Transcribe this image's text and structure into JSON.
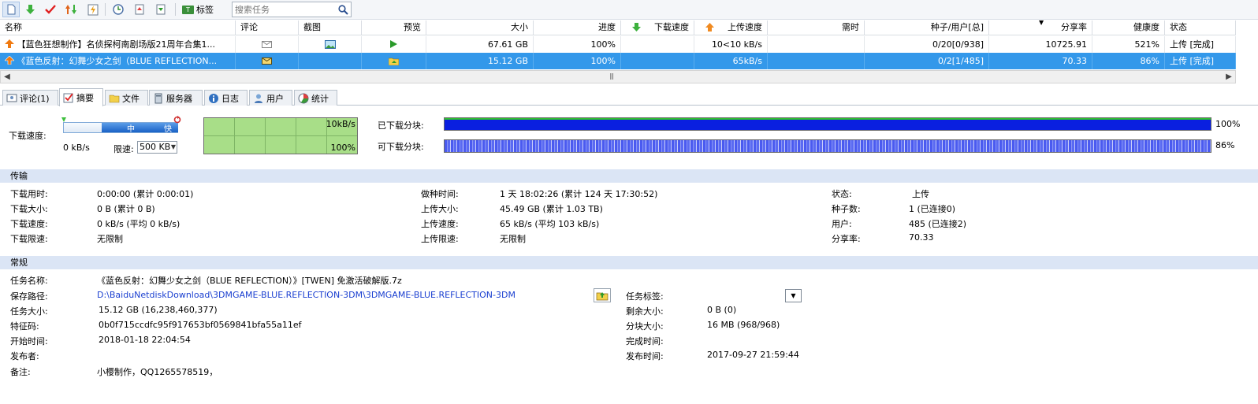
{
  "toolbar": {
    "tag_label": "标签",
    "search_placeholder": "搜索任务",
    "buttons": [
      "new-task-icon",
      "download-icon",
      "check-icon",
      "priority-icon",
      "lightning-icon",
      "schedule-icon",
      "import-icon",
      "export-icon"
    ]
  },
  "columns": {
    "name": "名称",
    "comment": "评论",
    "screenshot": "截图",
    "preview": "预览",
    "size": "大小",
    "progress": "进度",
    "down_speed": "下载速度",
    "up_speed": "上传速度",
    "time_left": "需时",
    "seeds_users": "种子/用户[总]",
    "share_ratio": "分享率",
    "health": "健康度",
    "status": "状态"
  },
  "tasks": [
    {
      "name": "【蓝色狂想制作】名侦探柯南剧场版21周年合集1...",
      "size": "67.61 GB",
      "progress": "100%",
      "down_speed": "",
      "up_speed": "10<10 kB/s",
      "time_left": "",
      "seeds_users": "0/20[0/938]",
      "share_ratio": "10725.91",
      "health": "521%",
      "status": "上传 [完成]"
    },
    {
      "name": "《蓝色反射：幻舞少女之剑（BLUE REFLECTION...",
      "size": "15.12 GB",
      "progress": "100%",
      "down_speed": "",
      "up_speed": "65kB/s",
      "time_left": "",
      "seeds_users": "0/2[1/485]",
      "share_ratio": "70.33",
      "health": "86%",
      "status": "上传 [完成]"
    }
  ],
  "tabs": [
    {
      "label": "评论(1)",
      "icon": "comment-icon"
    },
    {
      "label": "摘要",
      "icon": "summary-icon"
    },
    {
      "label": "文件",
      "icon": "folder-icon"
    },
    {
      "label": "服务器",
      "icon": "server-icon"
    },
    {
      "label": "日志",
      "icon": "info-icon"
    },
    {
      "label": "用户",
      "icon": "user-icon"
    },
    {
      "label": "统计",
      "icon": "stats-icon"
    }
  ],
  "speed": {
    "label": "下载速度:",
    "slider_mid": "中",
    "slider_fast": "快",
    "current": "0 kB/s",
    "limit_label": "限速:",
    "limit_value": "500 KB",
    "graph_top": "10kB/s",
    "graph_bottom": "100%"
  },
  "progress": {
    "downloaded_label": "已下载分块:",
    "downloaded_pct": "100%",
    "downloaded_fraction": 1.0,
    "available_label": "可下载分块:",
    "available_pct": "86%",
    "available_fraction": 0.86
  },
  "transfer": {
    "title": "传输",
    "download_time_label": "下载用时:",
    "download_time": "0:00:00 (累计 0:00:01)",
    "download_size_label": "下载大小:",
    "download_size": "0 B (累计 0 B)",
    "download_speed_label": "下载速度:",
    "download_speed": "0 kB/s (平均 0 kB/s)",
    "download_limit_label": "下载限速:",
    "download_limit": "无限制",
    "seed_time_label": "做种时间:",
    "seed_time": "1 天 18:02:26 (累计 124 天 17:30:52)",
    "upload_size_label": "上传大小:",
    "upload_size": "45.49 GB (累计 1.03 TB)",
    "upload_speed_label": "上传速度:",
    "upload_speed": "65 kB/s (平均 103 kB/s)",
    "upload_limit_label": "上传限速:",
    "upload_limit": "无限制",
    "status_label": "状态:",
    "status": "上传",
    "seeds_label": "种子数:",
    "seeds": "1 (已连接0)",
    "users_label": "用户:",
    "users": "485 (已连接2)",
    "ratio_label": "分享率:",
    "ratio": "70.33"
  },
  "general": {
    "title": "常规",
    "name_label": "任务名称:",
    "name": "《蓝色反射：幻舞少女之剑（BLUE REFLECTION）》[TWEN] 免激活破解版.7z",
    "path_label": "保存路径:",
    "path": "D:\\BaiduNetdiskDownload\\3DMGAME-BLUE.REFLECTION-3DM\\3DMGAME-BLUE.REFLECTION-3DM",
    "size_label": "任务大小:",
    "size": "15.12 GB (16,238,460,377)",
    "hash_label": "特征码:",
    "hash": "0b0f715ccdfc95f917653bf0569841bfa55a11ef",
    "start_label": "开始时间:",
    "start": "2018-01-18 22:04:54",
    "publisher_label": "发布者:",
    "publisher": "",
    "note_label": "备注:",
    "note": "小樱制作，QQ1265578519，",
    "tag_label": "任务标签:",
    "remaining_label": "剩余大小:",
    "remaining": "0 B (0)",
    "piece_label": "分块大小:",
    "piece": "16 MB (968/968)",
    "finish_label": "完成时间:",
    "finish": "",
    "publish_time_label": "发布时间:",
    "publish_time": "2017-09-27 21:59:44"
  }
}
